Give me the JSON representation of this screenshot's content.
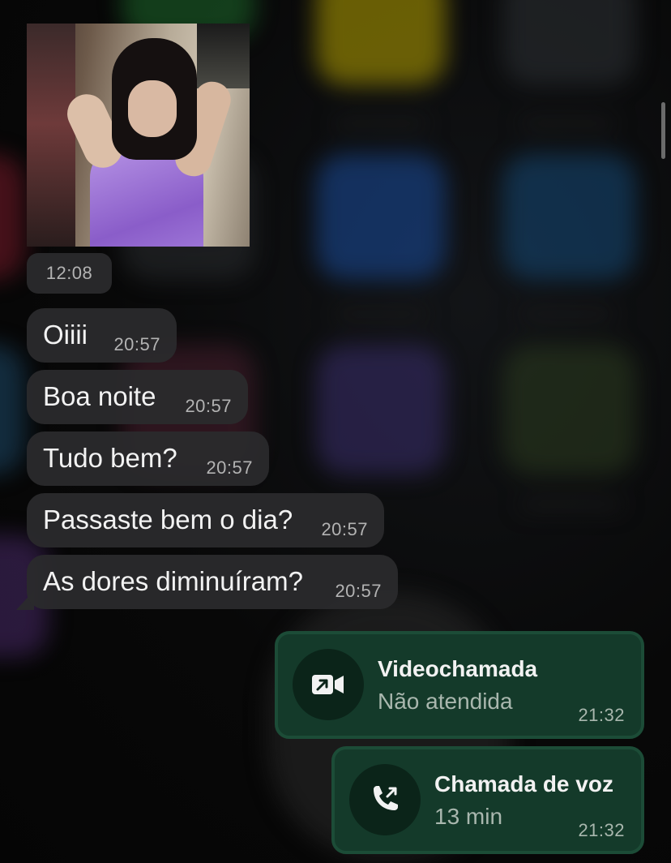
{
  "theme": {
    "incoming_bubble": "#2a2a2c",
    "outgoing_card": "#143a2a",
    "outgoing_border": "#1c4c37",
    "icon_circle": "#0b2419",
    "text_primary": "#f2f2f2",
    "text_secondary": "#b3b3b3"
  },
  "media_message": {
    "image_alt": "girl-in-purple-dress-gif",
    "time": "12:08"
  },
  "messages": [
    {
      "text": "Oiiii",
      "time": "20:57"
    },
    {
      "text": "Boa noite",
      "time": "20:57"
    },
    {
      "text": "Tudo bem?",
      "time": "20:57"
    },
    {
      "text": "Passaste bem o dia?",
      "time": "20:57"
    },
    {
      "text": "As dores diminuíram?",
      "time": "20:57"
    }
  ],
  "calls": [
    {
      "icon": "video-call-outgoing-icon",
      "title": "Videochamada",
      "subtitle": "Não atendida",
      "time": "21:32"
    },
    {
      "icon": "voice-call-outgoing-icon",
      "title": "Chamada de voz",
      "subtitle": "13 min",
      "time": "21:32"
    }
  ]
}
